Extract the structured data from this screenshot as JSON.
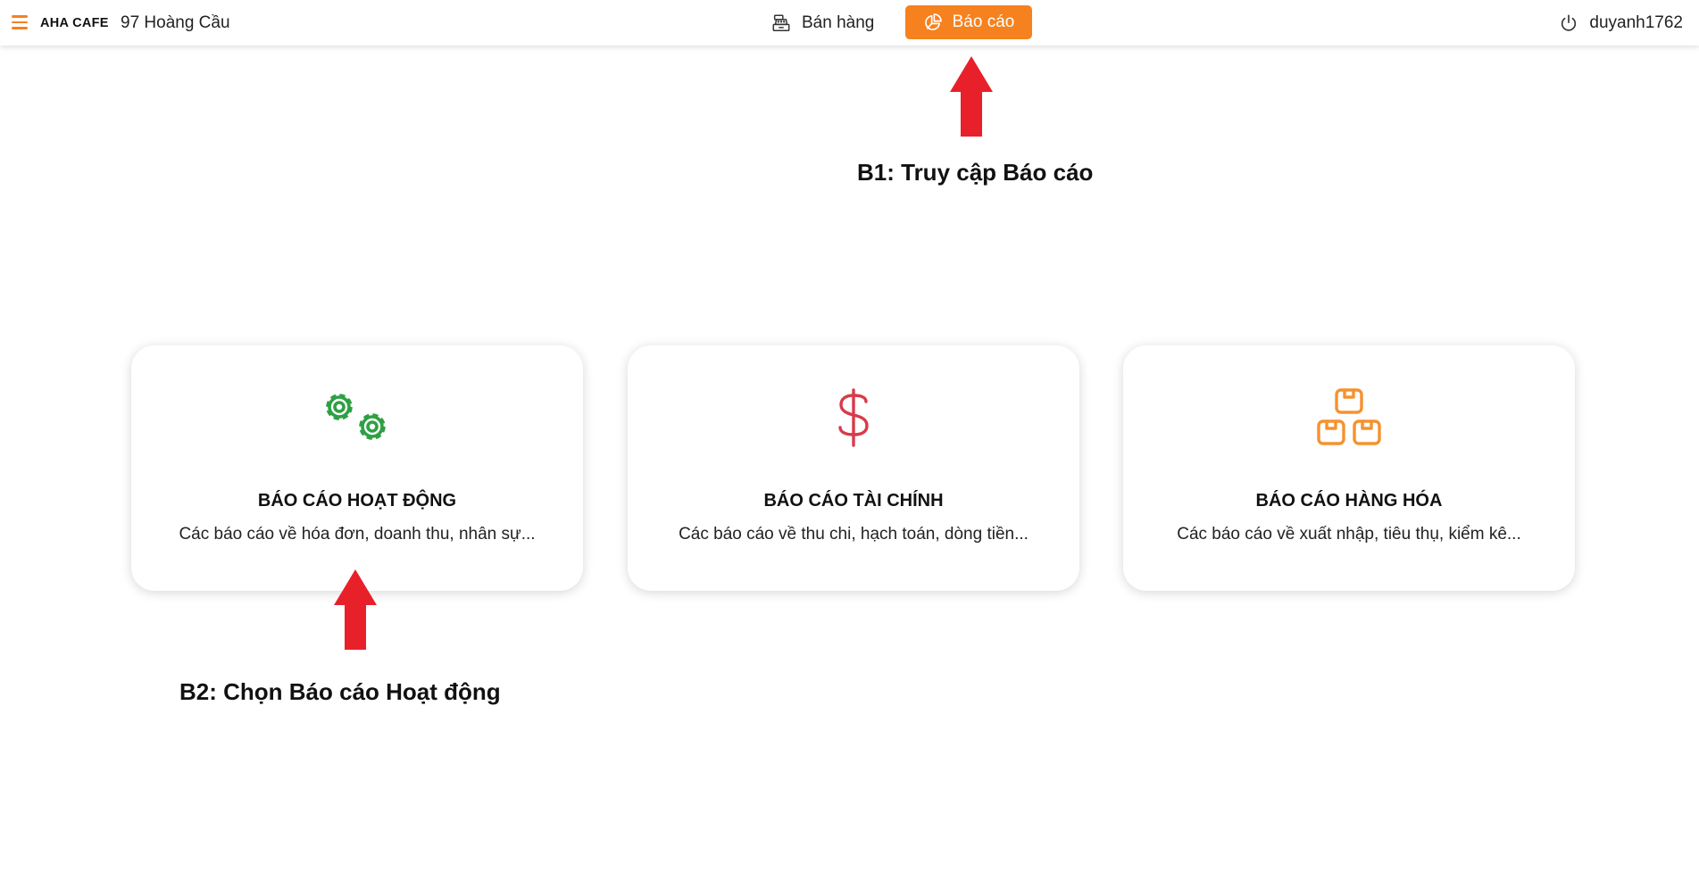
{
  "topbar": {
    "brand": "AHA CAFE",
    "branch": "97 Hoàng Cầu",
    "nav_sale_label": "Bán hàng",
    "nav_report_label": "Báo cáo",
    "username": "duyanh1762"
  },
  "annotations": {
    "step1": "B1: Truy cập Báo cáo",
    "step2": "B2: Chọn Báo cáo Hoạt động"
  },
  "cards": [
    {
      "title": "BÁO CÁO HOẠT ĐỘNG",
      "description": "Các báo cáo về hóa đơn, doanh thu, nhân sự...",
      "icon": "gears-icon",
      "color": "#2ea043"
    },
    {
      "title": "BÁO CÁO TÀI CHÍNH",
      "description": "Các báo cáo về thu chi, hạch toán, dòng tiền...",
      "icon": "dollar-icon",
      "color": "#d93a4a"
    },
    {
      "title": "BÁO CÁO HÀNG HÓA",
      "description": "Các báo cáo về xuất nhập, tiêu thụ, kiểm kê...",
      "icon": "boxes-icon",
      "color": "#f5922f"
    }
  ],
  "colors": {
    "accent": "#f5821f",
    "arrow": "#e8202a"
  }
}
